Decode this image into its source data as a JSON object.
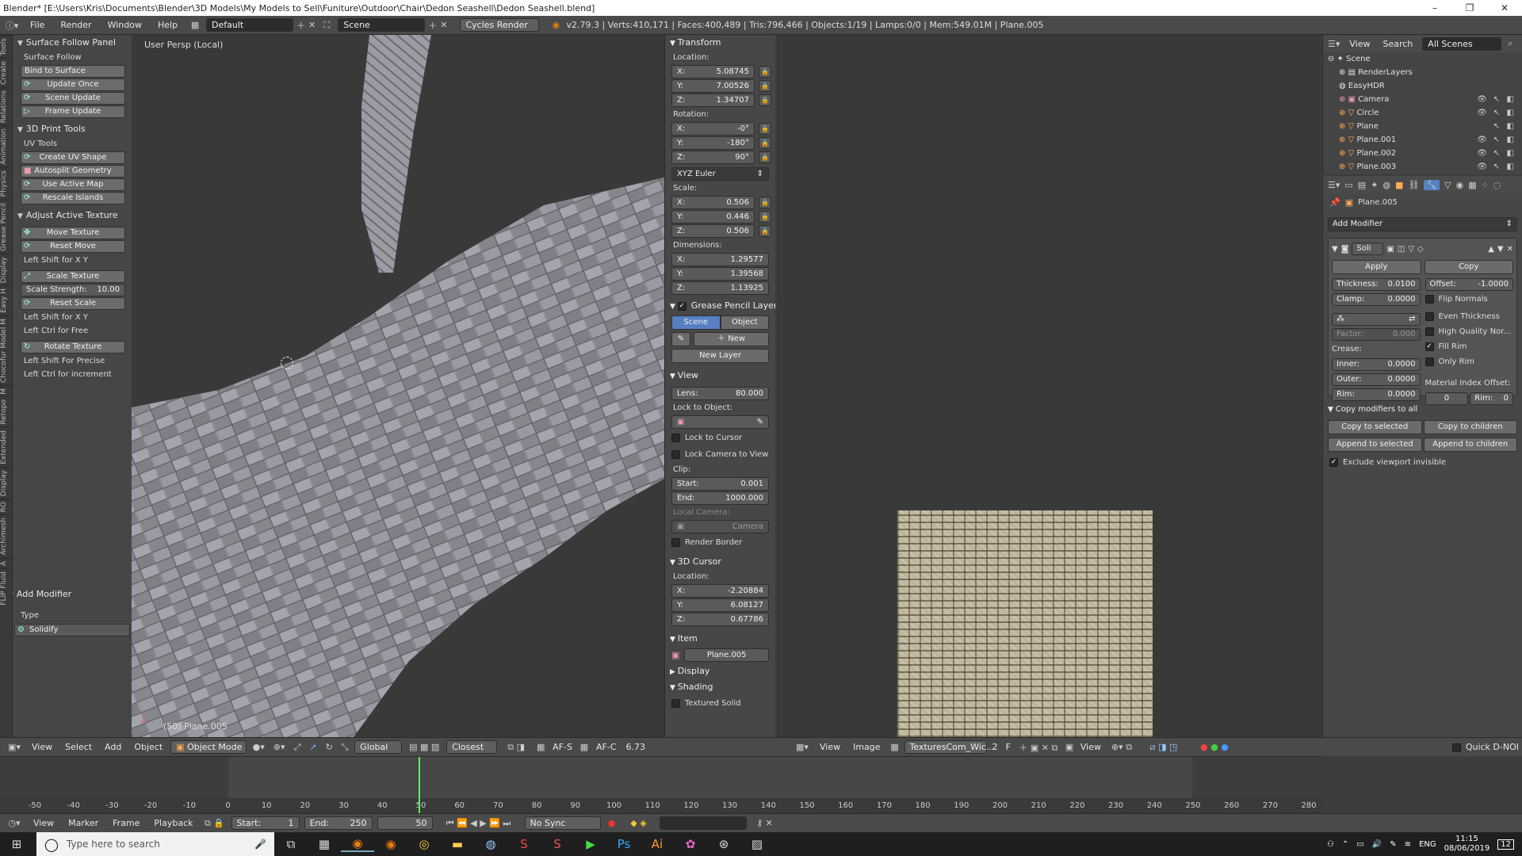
{
  "window": {
    "title": "Blender* [E:\\Users\\Kris\\Documents\\Blender\\3D Models\\My Models to Sell\\Funiture\\Outdoor\\Chair\\Dedon Seashell\\Dedon Seashell.blend]"
  },
  "menubar": {
    "items": [
      "File",
      "Render",
      "Window",
      "Help"
    ],
    "screen_layout": "Default",
    "scene": "Scene",
    "engine": "Cycles Render",
    "stats": "v2.79.3 | Verts:410,171 | Faces:400,489 | Tris:796,466 | Objects:1/19 | Lamps:0/0 | Mem:549.01M | Plane.005"
  },
  "left_tabs": [
    "Tools",
    "Create",
    "Relations",
    "Animation",
    "Physics",
    "Grease Pencil",
    "Display",
    "Easy H",
    "Chocofur Model M",
    "M",
    "Retopo",
    "Extended",
    "Display",
    "RO",
    "Archimesh",
    "A",
    "FLIP Fluid"
  ],
  "tool_panel": {
    "surface_follow": {
      "title": "Surface Follow Panel",
      "label": "Surface Follow",
      "buttons": [
        "Bind to Surface",
        "Update Once",
        "Scene Update",
        "Frame Update"
      ]
    },
    "print_tools": {
      "title": "3D Print Tools",
      "label": "UV Tools",
      "buttons": [
        "Create UV Shape",
        "Autosplit Geometry",
        "Use Active Map",
        "Rescale Islands"
      ]
    },
    "adjust_texture": {
      "title": "Adjust Active Texture",
      "move": "Move Texture",
      "reset_move": "Reset Move",
      "hint1": "Left Shift for X Y",
      "scale": "Scale Texture",
      "scale_strength_label": "Scale Strength:",
      "scale_strength": "10.00",
      "reset_scale": "Reset Scale",
      "hint2": "Left Shift for X Y",
      "hint3": "Left Ctrl for Free",
      "rotate": "Rotate Texture",
      "hint4": "Left Shift For Precise",
      "hint5": "Left Ctrl for increment"
    },
    "add_modifier": {
      "title": "Add Modifier",
      "type_label": "Type",
      "type_value": "Solidify"
    }
  },
  "viewport": {
    "label": "User Persp (Local)",
    "object_label": "(50) Plane.005"
  },
  "n_panel": {
    "transform_title": "Transform",
    "location_label": "Location:",
    "location": [
      {
        "a": "X:",
        "v": "5.08745"
      },
      {
        "a": "Y:",
        "v": "7.00526"
      },
      {
        "a": "Z:",
        "v": "1.34707"
      }
    ],
    "rotation_label": "Rotation:",
    "rotation": [
      {
        "a": "X:",
        "v": "-0°"
      },
      {
        "a": "Y:",
        "v": "-180°"
      },
      {
        "a": "Z:",
        "v": "90°"
      }
    ],
    "rotation_mode": "XYZ Euler",
    "scale_label": "Scale:",
    "scale": [
      {
        "a": "X:",
        "v": "0.506"
      },
      {
        "a": "Y:",
        "v": "0.446"
      },
      {
        "a": "Z:",
        "v": "0.506"
      }
    ],
    "dimensions_label": "Dimensions:",
    "dimensions": [
      {
        "a": "X:",
        "v": "1.29577"
      },
      {
        "a": "Y:",
        "v": "1.39568"
      },
      {
        "a": "Z:",
        "v": "1.13925"
      }
    ],
    "grease_title": "Grease Pencil Layers",
    "grease_scene": "Scene",
    "grease_object": "Object",
    "grease_new": "New",
    "grease_new_layer": "New Layer",
    "view_title": "View",
    "lens_label": "Lens:",
    "lens": "80.000",
    "lock_to_object": "Lock to Object:",
    "lock_to_cursor": "Lock to Cursor",
    "lock_camera": "Lock Camera to View",
    "clip_label": "Clip:",
    "clip_start_label": "Start:",
    "clip_start": "0.001",
    "clip_end_label": "End:",
    "clip_end": "1000.000",
    "local_camera_label": "Local Camera:",
    "local_camera": "Camera",
    "render_border": "Render Border",
    "cursor_title": "3D Cursor",
    "cursor_location_label": "Location:",
    "cursor": [
      {
        "a": "X:",
        "v": "-2.20884"
      },
      {
        "a": "Y:",
        "v": "6.08127"
      },
      {
        "a": "Z:",
        "v": "0.67786"
      }
    ],
    "item_title": "Item",
    "item_name": "Plane.005",
    "display_title": "Display",
    "shading_title": "Shading",
    "textured_solid": "Textured Solid"
  },
  "outliner": {
    "view": "View",
    "search": "Search",
    "filter": "All Scenes",
    "rows": [
      "Scene",
      "RenderLayers",
      "EasyHDR",
      "Camera",
      "Circle",
      "Plane",
      "Plane.001",
      "Plane.002",
      "Plane.003"
    ]
  },
  "properties": {
    "object_name": "Plane.005",
    "add_modifier": "Add Modifier",
    "mod_name": "Soli",
    "apply": "Apply",
    "copy": "Copy",
    "thickness_label": "Thickness:",
    "thickness": "0.0100",
    "offset_label": "Offset:",
    "offset": "-1.0000",
    "clamp_label": "Clamp:",
    "clamp": "0.0000",
    "flip_normals": "Flip Normals",
    "even_thickness": "Even Thickness",
    "high_quality": "High Quality Nor...",
    "fill_rim": "Fill Rim",
    "only_rim": "Only Rim",
    "factor_label": "Factor:",
    "factor": "0.000",
    "crease_label": "Crease:",
    "inner_label": "Inner:",
    "inner": "0.0000",
    "outer_label": "Outer:",
    "outer": "0.0000",
    "rim_label": "Rim:",
    "rim": "0.0000",
    "mat_offset_label": "Material Index Offset:",
    "mat_offset": "0",
    "mat_rim_label": "Rim:",
    "mat_rim": "0",
    "copy_mods_title": "Copy modifiers to all",
    "copy_selected": "Copy to selected",
    "copy_children": "Copy to children",
    "append_selected": "Append to selected",
    "append_children": "Append to children",
    "exclude_invisible": "Exclude viewport invisible"
  },
  "viewport_header": {
    "items": [
      "View",
      "Select",
      "Add",
      "Object"
    ],
    "mode": "Object Mode",
    "orientation": "Global",
    "snap": "Closest",
    "af_s": "AF-S",
    "af_c": "AF-C",
    "value": "6.73"
  },
  "image_header": {
    "view": "View",
    "image": "Image",
    "texture": "TexturesCom_Wic...",
    "users": "2",
    "fake": "F",
    "view2": "View",
    "quick": "Quick D-NOI"
  },
  "timeline": {
    "ticks": [
      -50,
      -40,
      -30,
      -20,
      -10,
      0,
      10,
      20,
      30,
      40,
      50,
      60,
      70,
      80,
      90,
      100,
      110,
      120,
      130,
      140,
      150,
      160,
      170,
      180,
      190,
      200,
      210,
      220,
      230,
      240,
      250,
      260,
      270,
      280
    ],
    "items": [
      "View",
      "Marker",
      "Frame",
      "Playback"
    ],
    "start_label": "Start:",
    "start": "1",
    "end_label": "End:",
    "end": "250",
    "current": "50",
    "sync": "No Sync"
  },
  "taskbar": {
    "search_placeholder": "Type here to search",
    "lang": "ENG",
    "time": "11:15",
    "date": "08/06/2019",
    "notif": "12"
  }
}
